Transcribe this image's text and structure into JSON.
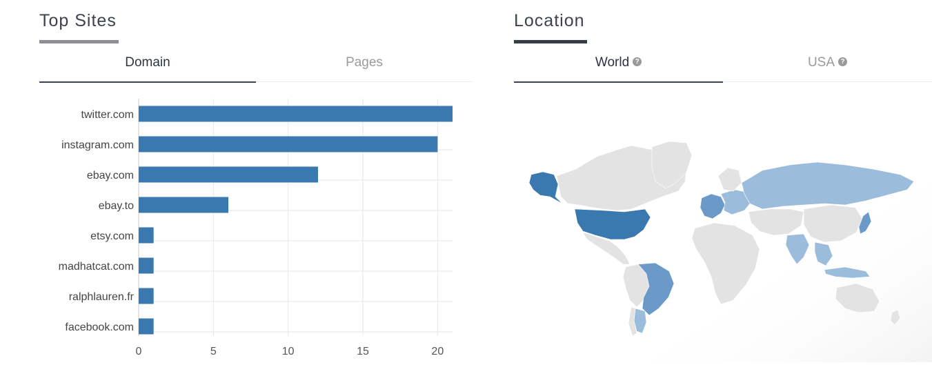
{
  "top_sites": {
    "title": "Top Sites",
    "tabs": [
      {
        "label": "Domain",
        "active": true
      },
      {
        "label": "Pages",
        "active": false
      }
    ]
  },
  "location": {
    "title": "Location",
    "tabs": [
      {
        "label": "World",
        "active": true,
        "help_icon": "question-circle-icon"
      },
      {
        "label": "USA",
        "active": false,
        "help_icon": "question-circle-icon"
      }
    ],
    "map": {
      "highlight_strong_color": "#3a78b0",
      "highlight_medium_color": "#6b9ac8",
      "highlight_light_color": "#9cbcdc",
      "base_color": "#e3e3e3"
    }
  },
  "chart_data": {
    "type": "bar",
    "orientation": "horizontal",
    "categories": [
      "twitter.com",
      "instagram.com",
      "ebay.com",
      "ebay.to",
      "etsy.com",
      "madhatcat.com",
      "ralphlauren.fr",
      "facebook.com"
    ],
    "values": [
      21,
      20,
      12,
      6,
      1,
      1,
      1,
      1
    ],
    "xlim": [
      0,
      21
    ],
    "xticks": [
      0,
      5,
      10,
      15,
      20
    ],
    "grid": true,
    "bar_color": "#3a78b0"
  }
}
